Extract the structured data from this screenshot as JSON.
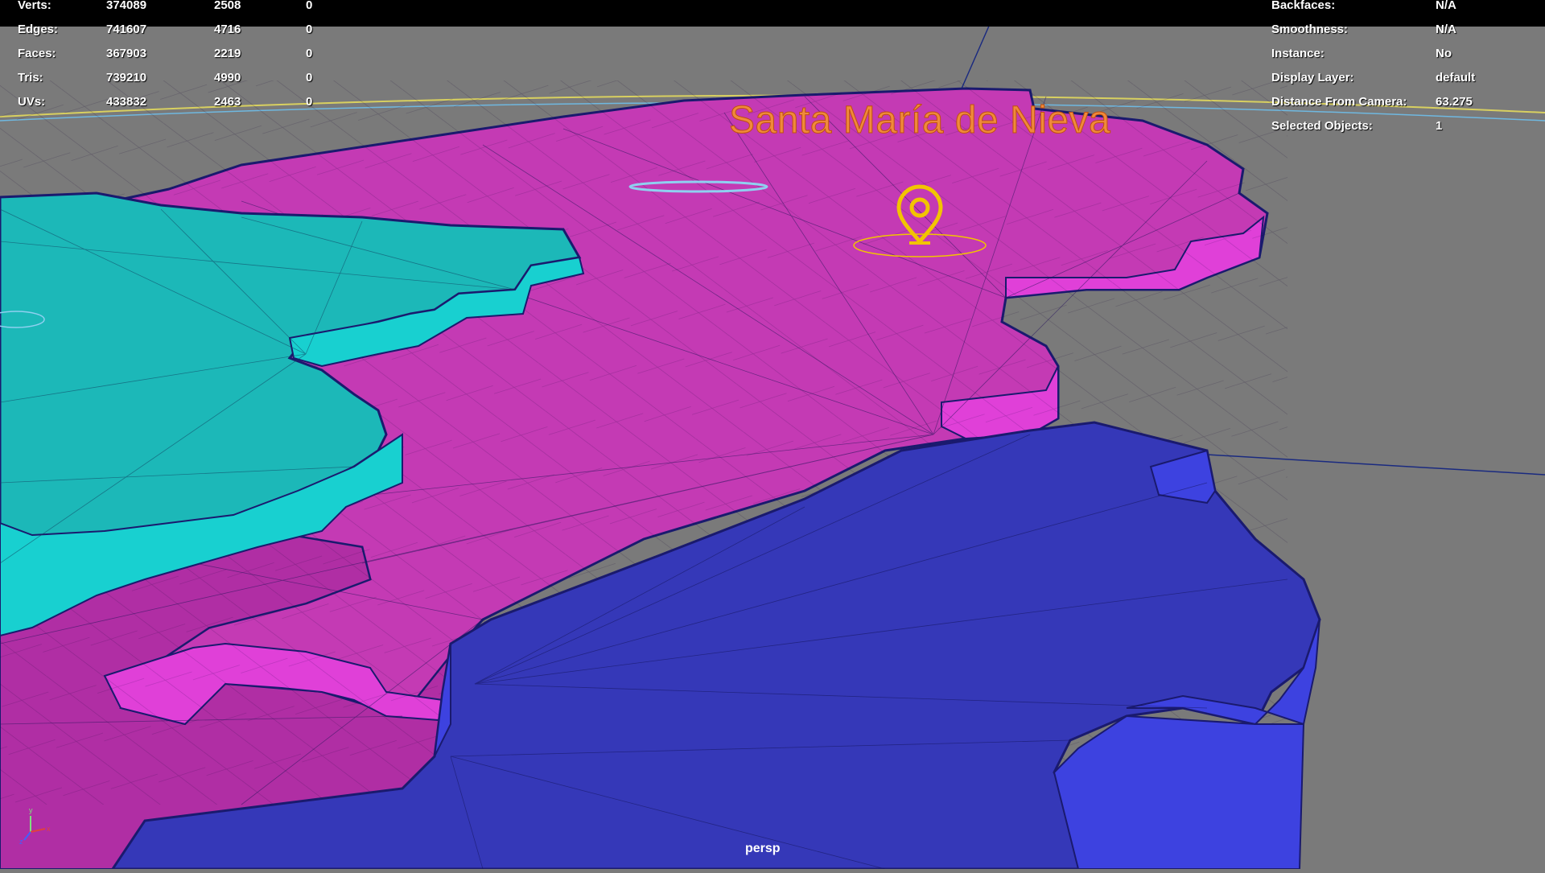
{
  "hud": {
    "stats": [
      {
        "label": "Verts:",
        "v1": "374089",
        "v2": "2508",
        "v3": "0"
      },
      {
        "label": "Edges:",
        "v1": "741607",
        "v2": "4716",
        "v3": "0"
      },
      {
        "label": "Faces:",
        "v1": "367903",
        "v2": "2219",
        "v3": "0"
      },
      {
        "label": "Tris:",
        "v1": "739210",
        "v2": "4990",
        "v3": "0"
      },
      {
        "label": "UVs:",
        "v1": "433832",
        "v2": "2463",
        "v3": "0"
      }
    ],
    "info": [
      {
        "label": "Backfaces:",
        "value": "N/A"
      },
      {
        "label": "Smoothness:",
        "value": "N/A"
      },
      {
        "label": "Instance:",
        "value": "No"
      },
      {
        "label": "Display Layer:",
        "value": "default"
      },
      {
        "label": "Distance From Camera:",
        "value": "63.275"
      },
      {
        "label": "Selected Objects:",
        "value": "1"
      }
    ]
  },
  "scene": {
    "place_label": "Santa María de Nieva",
    "camera_name": "persp",
    "colors": {
      "background": "#7a7a7a",
      "region_magenta": "#c43ab4",
      "region_magenta_side": "#e040d8",
      "region_teal": "#1cb8b8",
      "region_teal_side": "#18d0d0",
      "region_blue": "#3538b8",
      "region_blue_side": "#3d42e0",
      "wire": "#1a1a6e",
      "label": "#f08a3a",
      "pin": "#f2c400"
    },
    "icons": [
      "location-pin-icon",
      "axis-gizmo-icon"
    ]
  }
}
